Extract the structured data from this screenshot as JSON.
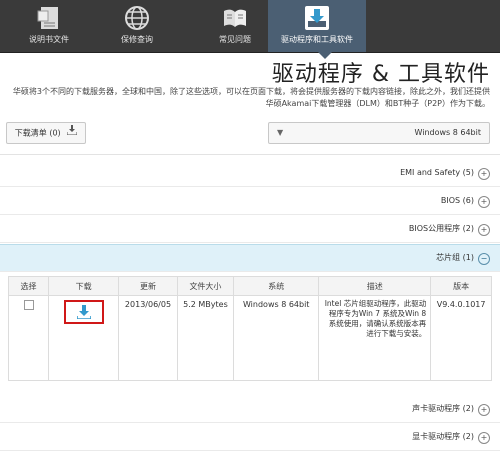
{
  "nav": {
    "items": [
      {
        "label": "驱动程序和工具软件",
        "icon": "download-tray-icon",
        "active": true
      },
      {
        "label": "常见问题",
        "icon": "book-icon",
        "active": false
      },
      {
        "label": "保修查询",
        "icon": "globe-icon",
        "active": false
      },
      {
        "label": "说明书文件",
        "icon": "document-icon",
        "active": false
      }
    ]
  },
  "page": {
    "title": "驱动程序 & 工具软件",
    "description": "华硕将3个不同的下载服务器，全球和中国，除了这些选项，可以在页面下载，将会提供服务器的下载内容链接，除此之外，我们还提供华硕Akamai下载管理器（DLM）和BT种子（P2P）作为下载。"
  },
  "os_select": {
    "value": "Windows 8 64bit",
    "arrow": "▼"
  },
  "download_cart": {
    "label": "下载清单 (0)",
    "icon": "cart-download-icon"
  },
  "categories_top": [
    {
      "label": "EMI and Safety (5)",
      "sign": "+"
    },
    {
      "label": "BIOS (6)",
      "sign": "+"
    },
    {
      "label": "BIOS公用程序 (2)",
      "sign": "+"
    }
  ],
  "category_open": {
    "label": "芯片组 (1)",
    "sign": "−"
  },
  "table": {
    "headers": {
      "version": "版本",
      "description": "描述",
      "os": "系统",
      "size": "文件大小",
      "date": "更新",
      "download": "下载",
      "select": "选择"
    },
    "rows": [
      {
        "version": "V9.4.0.1017",
        "description": "Intel 芯片组驱动程序，此驱动程序专为Win 7 系统及Win 8 系统使用，请确认系统版本再进行下载与安装。",
        "os": "Windows 8 64bit",
        "size": "5.2 MBytes",
        "date": "2013/06/05"
      }
    ]
  },
  "categories_bottom": [
    {
      "label": "声卡驱动程序 (2)",
      "sign": "+"
    },
    {
      "label": "显卡驱动程序 (2)",
      "sign": "+"
    }
  ],
  "colors": {
    "nav_bg": "#3a3a3a",
    "nav_active": "#4b5f73",
    "download_accent": "#3399cc",
    "highlight_border": "#d01818"
  }
}
